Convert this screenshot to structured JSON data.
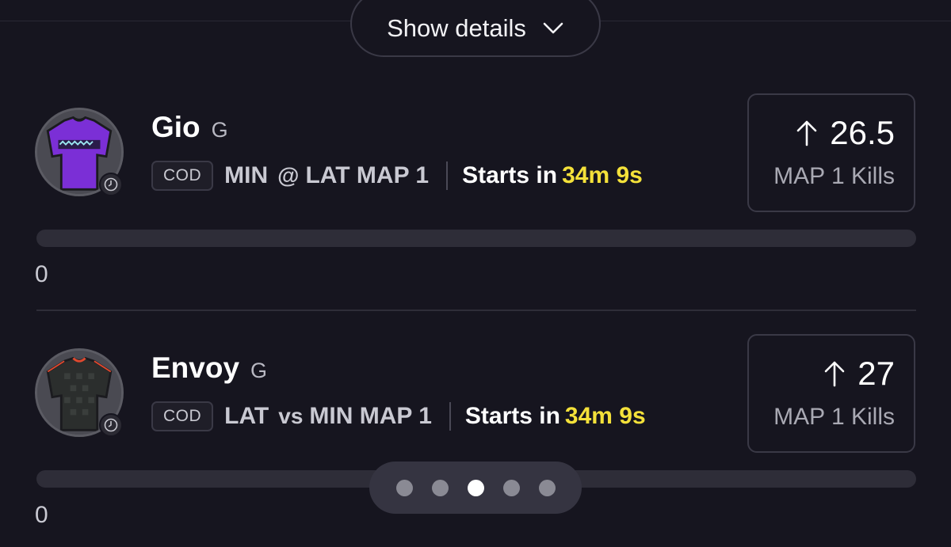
{
  "show_details": {
    "label": "Show details",
    "icon": "chevron-down-icon"
  },
  "colors": {
    "background": "#16151f",
    "accent_time": "#f4e13a",
    "border": "#3a3946"
  },
  "players": [
    {
      "name": "Gio",
      "position": "G",
      "jersey": "purple-jersey-icon",
      "league": "COD",
      "team": "MIN",
      "separator": "@",
      "opponent": "LAT MAP 1",
      "starts_label": "Starts in",
      "starts_time": "34m 9s",
      "direction_icon": "arrow-up-icon",
      "projection": "26.5",
      "stat": "MAP 1 Kills",
      "progress": 0,
      "progress_label": "0"
    },
    {
      "name": "Envoy",
      "position": "G",
      "jersey": "black-jersey-icon",
      "league": "COD",
      "team": "LAT",
      "separator": "vs",
      "opponent": "MIN MAP 1",
      "starts_label": "Starts in",
      "starts_time": "34m 9s",
      "direction_icon": "arrow-up-icon",
      "projection": "27",
      "stat": "MAP 1 Kills",
      "progress": 0,
      "progress_label": "0"
    }
  ],
  "pager": {
    "count": 5,
    "active_index": 2
  }
}
